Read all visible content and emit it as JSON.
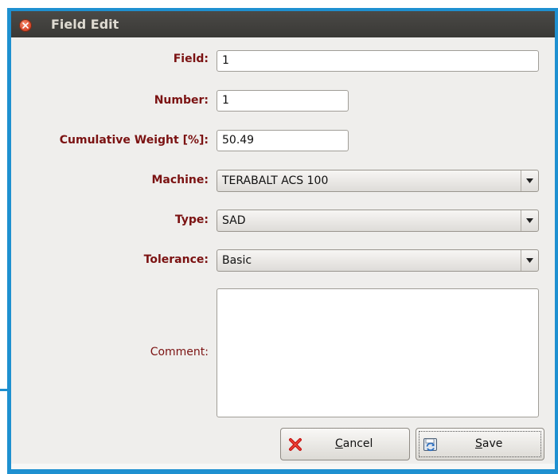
{
  "window": {
    "title": "Field Edit"
  },
  "form": {
    "field": {
      "label": "Field:",
      "value": "1"
    },
    "number": {
      "label": "Number:",
      "value": "1"
    },
    "cumulative_weight": {
      "label": "Cumulative Weight [%]:",
      "value": "50.49"
    },
    "machine": {
      "label": "Machine:",
      "value": "TERABALT ACS 100"
    },
    "type": {
      "label": "Type:",
      "value": "SAD"
    },
    "tolerance": {
      "label": "Tolerance:",
      "value": "Basic"
    },
    "comment": {
      "label": "Comment:",
      "value": ""
    }
  },
  "buttons": {
    "cancel": {
      "mnemonic": "C",
      "rest": "ancel"
    },
    "save": {
      "mnemonic": "S",
      "rest": "ave"
    }
  },
  "icons": {
    "close": "close-icon",
    "dropdown": "chevron-down-icon",
    "cancel": "red-x-icon",
    "save": "save-refresh-icon"
  },
  "colors": {
    "label": "#7b1212",
    "titlebar": "#3c3b37",
    "window_bg": "#efeeec",
    "frame_accent": "#1e90d0"
  }
}
